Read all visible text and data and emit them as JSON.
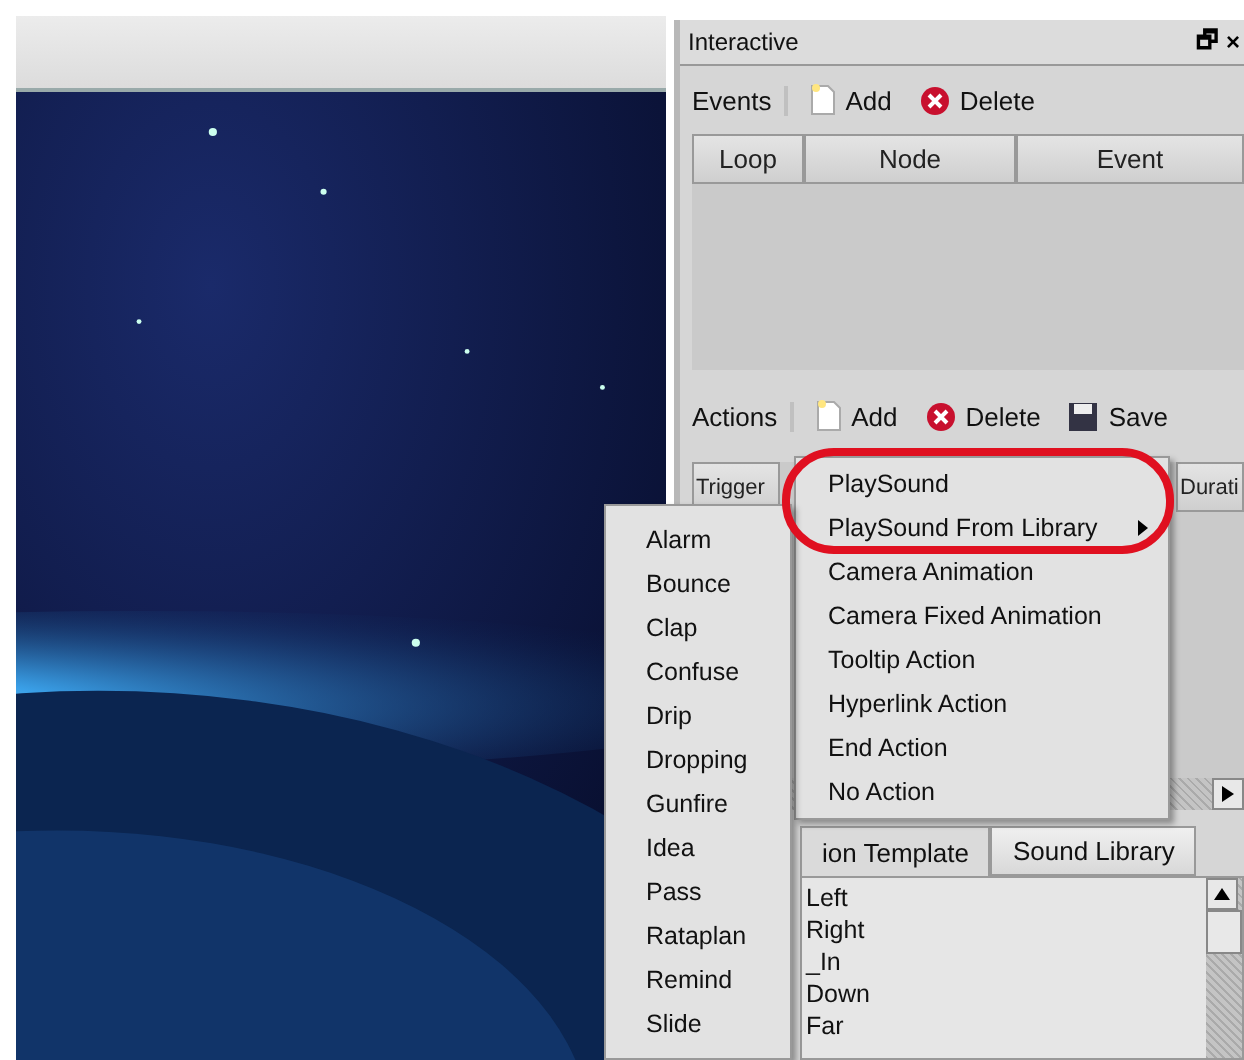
{
  "window": {
    "title": "Interactive",
    "controls": [
      "🗗",
      "×"
    ]
  },
  "events": {
    "label": "Events",
    "buttons": [
      {
        "label": "Add",
        "kind": "add"
      },
      {
        "label": "Delete",
        "kind": "delete"
      }
    ],
    "columns": [
      "Loop",
      "Node",
      "Event"
    ]
  },
  "actions": {
    "label": "Actions",
    "buttons": [
      {
        "label": "Add",
        "kind": "add"
      },
      {
        "label": "Delete",
        "kind": "delete"
      },
      {
        "label": "Save",
        "kind": "save"
      }
    ],
    "columns": [
      "Trigger",
      "Durati"
    ]
  },
  "tabs": [
    {
      "label": "ion Template",
      "selected": true
    },
    {
      "label": "Sound Library",
      "selected": false
    }
  ],
  "list": [
    "Left",
    "Right",
    "_In",
    "Down",
    "Far"
  ],
  "action_menu": [
    {
      "label": "PlaySound",
      "submenu": false
    },
    {
      "label": "PlaySound From Library",
      "submenu": true
    },
    {
      "label": "Camera Animation",
      "submenu": false
    },
    {
      "label": "Camera Fixed Animation",
      "submenu": false
    },
    {
      "label": "Tooltip Action",
      "submenu": false
    },
    {
      "label": "Hyperlink Action",
      "submenu": false
    },
    {
      "label": "End Action",
      "submenu": false
    },
    {
      "label": "No Action",
      "submenu": false
    }
  ],
  "sound_menu": [
    "Alarm",
    "Bounce",
    "Clap",
    "Confuse",
    "Drip",
    "Dropping",
    "Gunfire",
    "Idea",
    "Pass",
    "Rataplan",
    "Remind",
    "Slide"
  ]
}
